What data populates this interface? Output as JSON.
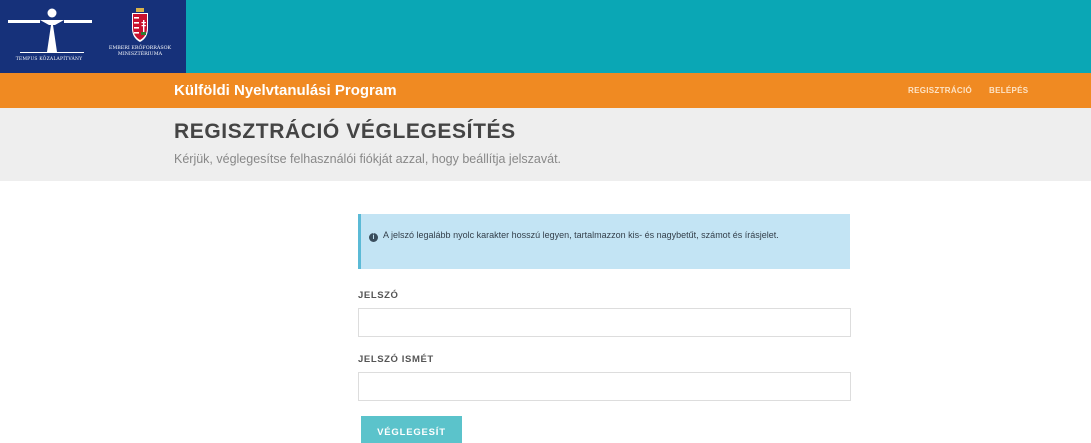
{
  "logos": {
    "tempus_text": "TEMPUS KÖZALAPÍTVÁNY",
    "emmi_line1": "EMBERI ERŐFORRÁSOK",
    "emmi_line2": "MINISZTÉRIUMA"
  },
  "navbar": {
    "brand": "Külföldi Nyelvtanulási Program",
    "links": [
      "REGISZTRÁCIÓ",
      "BELÉPÉS"
    ]
  },
  "header": {
    "title": "REGISZTRÁCIÓ VÉGLEGESÍTÉS",
    "subtitle": "Kérjük, véglegesítse felhasználói fiókját azzal, hogy beállítja jelszavát."
  },
  "alert": {
    "icon": "info-icon",
    "text": "A jelszó legalább nyolc karakter hosszú legyen, tartalmazzon kis- és nagybetűt, számot és írásjelet."
  },
  "form": {
    "password_label": "JELSZÓ",
    "password_value": "",
    "password_again_label": "JELSZÓ ISMÉT",
    "password_again_value": "",
    "submit_label": "VÉGLEGESÍT"
  },
  "colors": {
    "topbar": "#0aa7b5",
    "logo_block": "#16317a",
    "navbar": "#f08a22",
    "header_band": "#eeeeee",
    "alert_bg": "#c3e4f4",
    "button": "#5bc3cb"
  }
}
